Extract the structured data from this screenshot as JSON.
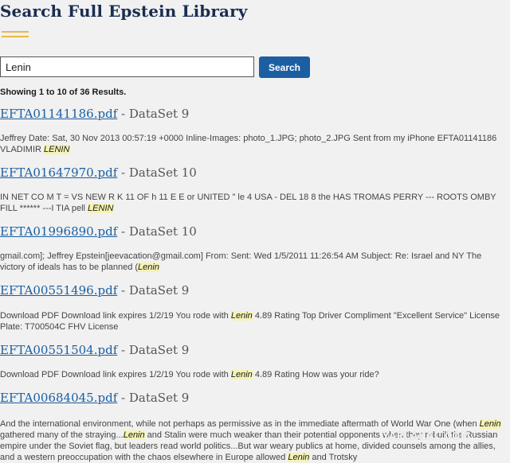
{
  "page": {
    "title": "Search Full Epstein Library"
  },
  "search": {
    "value": "Lenin",
    "button_label": "Search"
  },
  "results_summary": "Showing 1 to 10 of 36 Results.",
  "separator": " - ",
  "results": [
    {
      "file": "EFTA01141186.pdf",
      "dataset": "DataSet 9",
      "snippet_parts": [
        "Jeffrey Date: Sat, 30 Nov 2013 00:57:19 +0000 Inline-Images: photo_1.JPG; photo_2.JPG Sent from my iPhone EFTA01141186 VLADIMIR ",
        "LENIN",
        ""
      ]
    },
    {
      "file": "EFTA01647970.pdf",
      "dataset": "DataSet 10",
      "snippet_parts": [
        "IN NET CO M T = VS NEW R K 11 OF h 11 E E or UNITED \" le 4 USA - DEL 18 8 the HAS TROMAS PERRY --- ROOTS OMBY FILL ****** ---I TIA pell ",
        "LENIN",
        ""
      ]
    },
    {
      "file": "EFTA01996890.pdf",
      "dataset": "DataSet 10",
      "snippet_parts": [
        "gmail.com]; Jeffrey Epstein[jeevacation@gmail.com] From: Sent: Wed 1/5/2011 11:26:54 AM Subject: Re: Israel and NY The victory of ideals has to be planned (",
        "Lenin",
        ""
      ]
    },
    {
      "file": "EFTA00551496.pdf",
      "dataset": "DataSet 9",
      "snippet_parts": [
        "Download PDF Download link expires 1/2/19 You rode with ",
        "Lenin",
        " 4.89 Rating Top Driver Compliment \"Excellent Service\" License Plate: T700504C FHV License"
      ]
    },
    {
      "file": "EFTA00551504.pdf",
      "dataset": "DataSet 9",
      "snippet_parts": [
        "Download PDF Download link expires 1/2/19 You rode with ",
        "Lenin",
        " 4.89 Rating How was your ride?"
      ]
    },
    {
      "file": "EFTA00684045.pdf",
      "dataset": "DataSet 9",
      "snippet_parts": [
        "And the international environment, while not perhaps as permissive as in the immediate aftermath of World War One (when ",
        "Lenin",
        " gathered many of the straying...",
        "Lenin",
        " and Stalin were much weaker than their potential opponents when they rebuilt the Russian empire under the Soviet flag, but leaders read world politics...But war weary publics at home, divided counsels among the allies, and a western preoccupation with the chaos elsewhere in Europe allowed ",
        "Lenin",
        " and Trotsky"
      ]
    }
  ],
  "watermark": "YAPLAKAL.COM"
}
